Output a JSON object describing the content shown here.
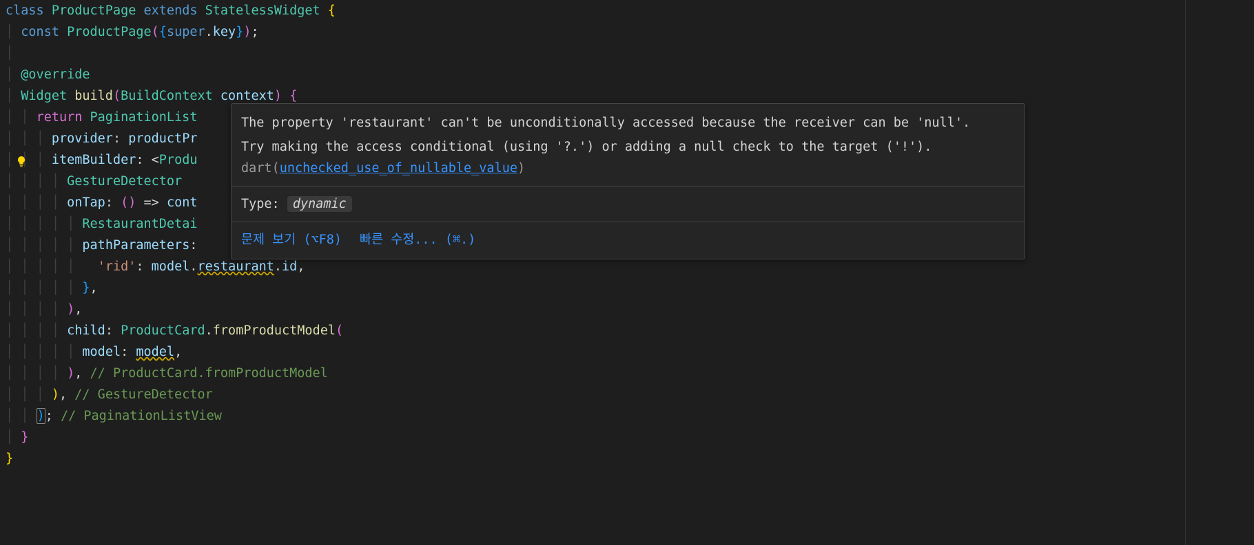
{
  "code": {
    "l1_class": "class",
    "l1_name": "ProductPage",
    "l1_extends": "extends",
    "l1_super": "StatelessWidget",
    "l2_const": "const",
    "l2_ctor": "ProductPage",
    "l2_super": "super",
    "l2_key": "key",
    "l4_anno": "@override",
    "l5_type": "Widget",
    "l5_method": "build",
    "l5_paramtype": "BuildContext",
    "l5_param": "context",
    "l6_return": "return",
    "l6_class": "PaginationList",
    "l7_provider": "provider",
    "l7_value": "productPr",
    "l8_item": "itemBuilder",
    "l8_generic": "Produ",
    "l9_class": "GestureDetector",
    "l10_ontap": "onTap",
    "l10_cont": "cont",
    "l11_class": "RestaurantDetai",
    "l12_path": "pathParameters",
    "l13_rid": "'rid'",
    "l13_model": "model",
    "l13_rest": "restaurant",
    "l13_id": "id",
    "l16_child": "child",
    "l16_class": "ProductCard",
    "l16_method": "fromProductModel",
    "l17_model": "model",
    "l17_val": "model",
    "l18_comment": "// ProductCard.fromProductModel",
    "l19_comment": "// GestureDetector",
    "l20_comment": "// PaginationListView"
  },
  "tooltip": {
    "msg1": "The property 'restaurant' can't be unconditionally accessed because the receiver can be 'null'.",
    "msg2a": "Try making the access conditional (using '?.') or adding a null check to the target ('!').",
    "msg2_dart": " dart",
    "msg2_link": "unchecked_use_of_nullable_value",
    "type_label": "Type: ",
    "type_value": "dynamic",
    "action1": "문제 보기 (⌥F8)",
    "action2": "빠른 수정... (⌘.)"
  }
}
